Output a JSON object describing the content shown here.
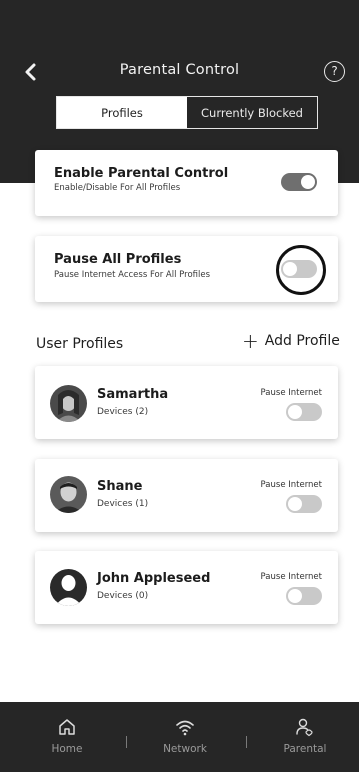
{
  "header": {
    "title": "Parental Control",
    "back_icon": "chevron-left-icon",
    "help_icon": "question-circle-icon",
    "help_glyph": "?"
  },
  "tabs": [
    {
      "label": "Profiles",
      "active": true
    },
    {
      "label": "Currently Blocked",
      "active": false
    }
  ],
  "enable_card": {
    "title": "Enable Parental Control",
    "subtitle": "Enable/Disable For All Profiles",
    "toggle_state": "on"
  },
  "pause_card": {
    "title": "Pause All Profiles",
    "subtitle": "Pause Internet Access For All Profiles",
    "toggle_state": "off"
  },
  "user_profiles": {
    "section_title": "User Profiles",
    "add_label": "Add Profile",
    "add_glyph": "+",
    "profiles": [
      {
        "name": "Samartha",
        "devices": "Devices (2)",
        "pause_label": "Pause Internet",
        "toggle_state": "off"
      },
      {
        "name": "Shane",
        "devices": "Devices (1)",
        "pause_label": "Pause Internet",
        "toggle_state": "off"
      },
      {
        "name": "John Appleseed",
        "devices": "Devices (0)",
        "pause_label": "Pause Internet",
        "toggle_state": "off"
      }
    ]
  },
  "bottom_nav": [
    {
      "label": "Home",
      "icon": "home-icon"
    },
    {
      "label": "Network",
      "icon": "wifi-icon"
    },
    {
      "label": "Parental",
      "icon": "parental-user-icon"
    }
  ],
  "colors": {
    "header_bg": "#262626",
    "toggle_on": "#6f6f6f",
    "toggle_off": "#c9c9c9",
    "nav_text": "#9a9a9a"
  }
}
